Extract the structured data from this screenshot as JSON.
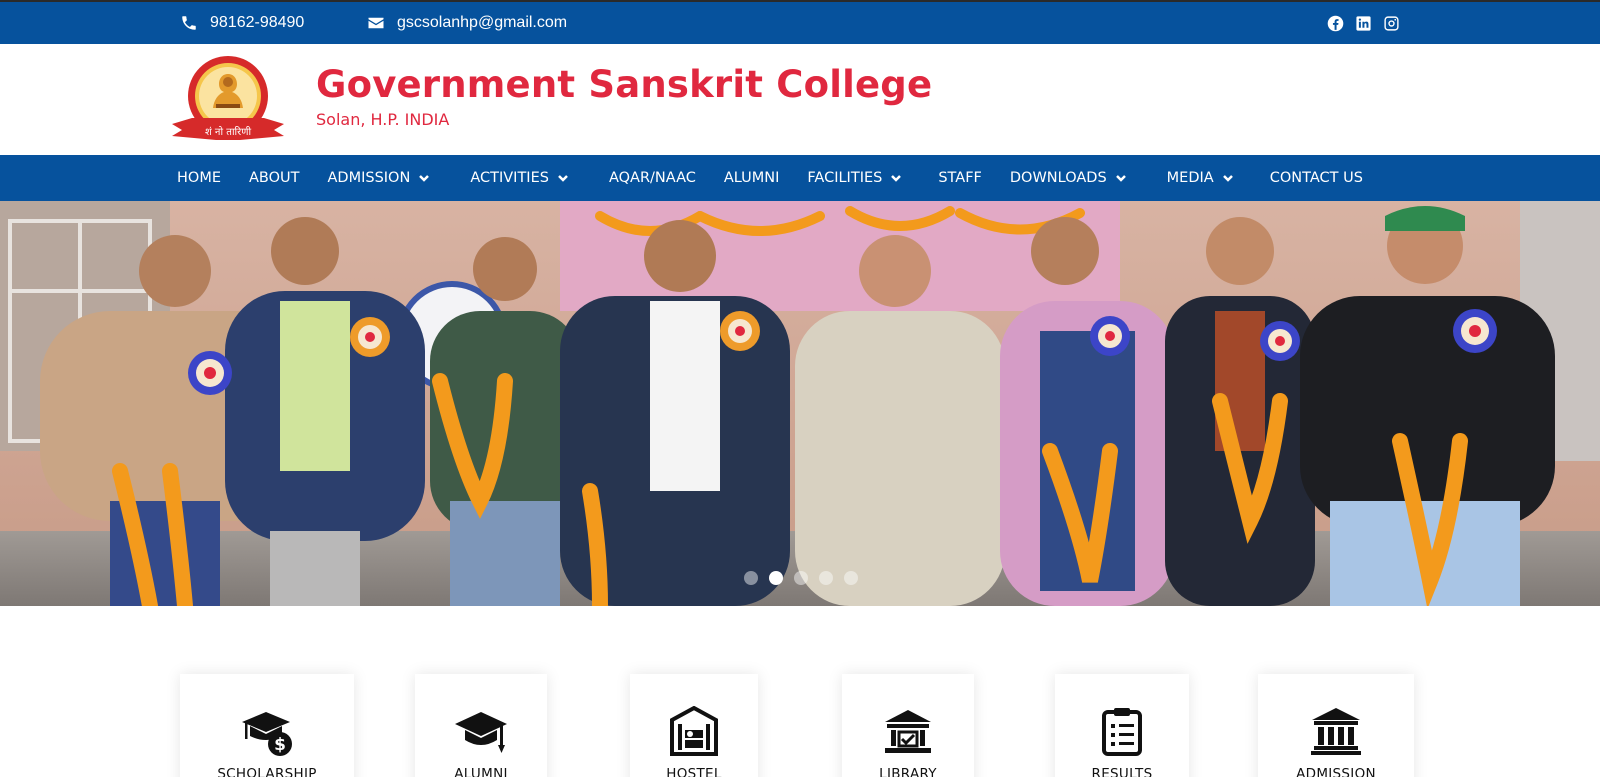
{
  "topbar": {
    "phone": "98162-98490",
    "email": "gscsolanhp@gmail.com",
    "social": [
      "facebook-icon",
      "linkedin-icon",
      "instagram-icon"
    ]
  },
  "header": {
    "title": "Government Sanskrit College",
    "subtitle": "Solan, H.P. INDIA",
    "logo_text": "शं नो तारिणी"
  },
  "nav": {
    "items": [
      {
        "label": "HOME",
        "dropdown": false
      },
      {
        "label": "ABOUT",
        "dropdown": false
      },
      {
        "label": "ADMISSION",
        "dropdown": true
      },
      {
        "label": "ACTIVITIES",
        "dropdown": true
      },
      {
        "label": "AQAR/NAAC",
        "dropdown": false
      },
      {
        "label": "ALUMNI",
        "dropdown": false
      },
      {
        "label": "FACILITIES",
        "dropdown": true
      },
      {
        "label": "STAFF",
        "dropdown": false
      },
      {
        "label": "DOWNLOADS",
        "dropdown": true
      },
      {
        "label": "MEDIA",
        "dropdown": true
      },
      {
        "label": "CONTACT US",
        "dropdown": false
      }
    ]
  },
  "carousel": {
    "slide_count": 5,
    "active_index": 1
  },
  "cards": [
    {
      "label": "SCHOLARSHIP",
      "icon": "scholarship-icon"
    },
    {
      "label": "ALUMNI",
      "icon": "graduation-cap-icon"
    },
    {
      "label": "HOSTEL",
      "icon": "hostel-icon"
    },
    {
      "label": "LIBRARY",
      "icon": "library-icon"
    },
    {
      "label": "RESULTS",
      "icon": "clipboard-icon"
    },
    {
      "label": "ADMISSION",
      "icon": "institution-icon"
    }
  ],
  "colors": {
    "brand_blue": "#06529d",
    "title_red": "#e0283f"
  }
}
